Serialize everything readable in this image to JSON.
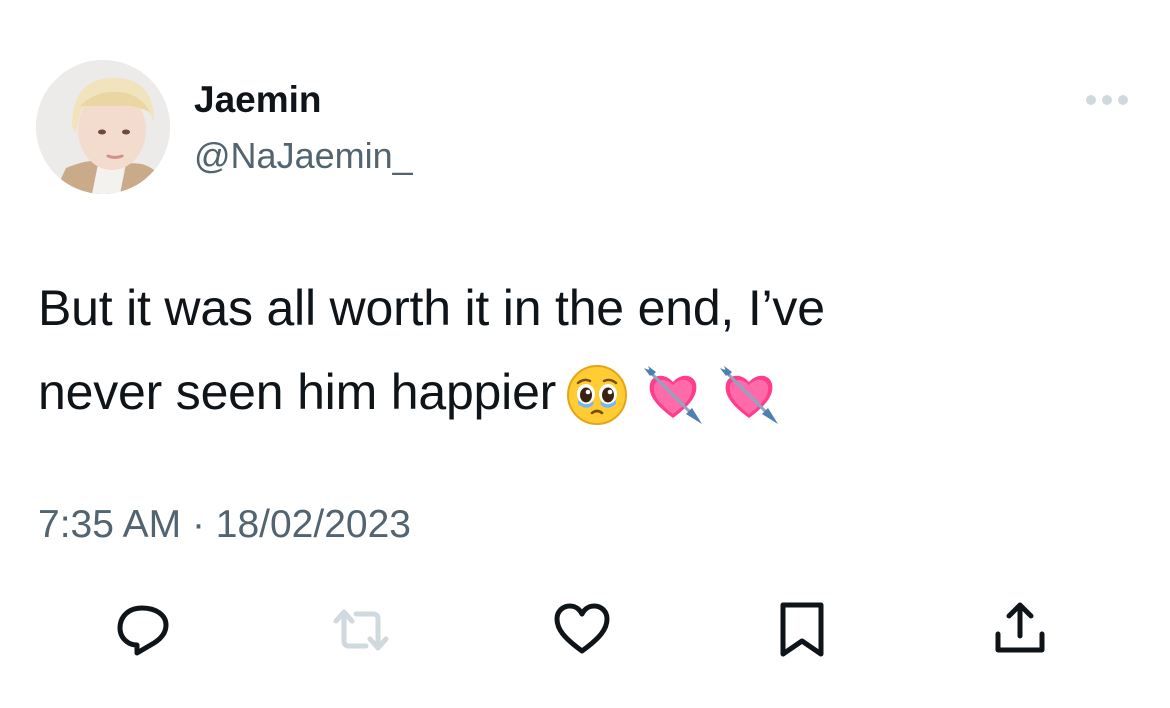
{
  "tweet": {
    "author": {
      "display_name": "Jaemin",
      "handle": "@NaJaemin_"
    },
    "text_line1": "But it was all worth it in the end, I’ve",
    "text_line2": "never seen him happier",
    "emojis": [
      "pleading-face-emoji",
      "heart-with-arrow-emoji",
      "heart-with-arrow-emoji"
    ],
    "time": "7:35 AM",
    "separator": "·",
    "date": "18/02/2023"
  },
  "icons": {
    "more": "more-horizontal-icon",
    "reply": "reply-bubble-icon",
    "retweet": "retweet-icon",
    "like": "heart-outline-icon",
    "bookmark": "bookmark-icon",
    "share": "share-icon"
  },
  "colors": {
    "text": "#0f1419",
    "secondary": "#536471",
    "retweet_disabled": "#cfd9de",
    "more_dots": "#cfd9de",
    "background": "#ffffff"
  }
}
